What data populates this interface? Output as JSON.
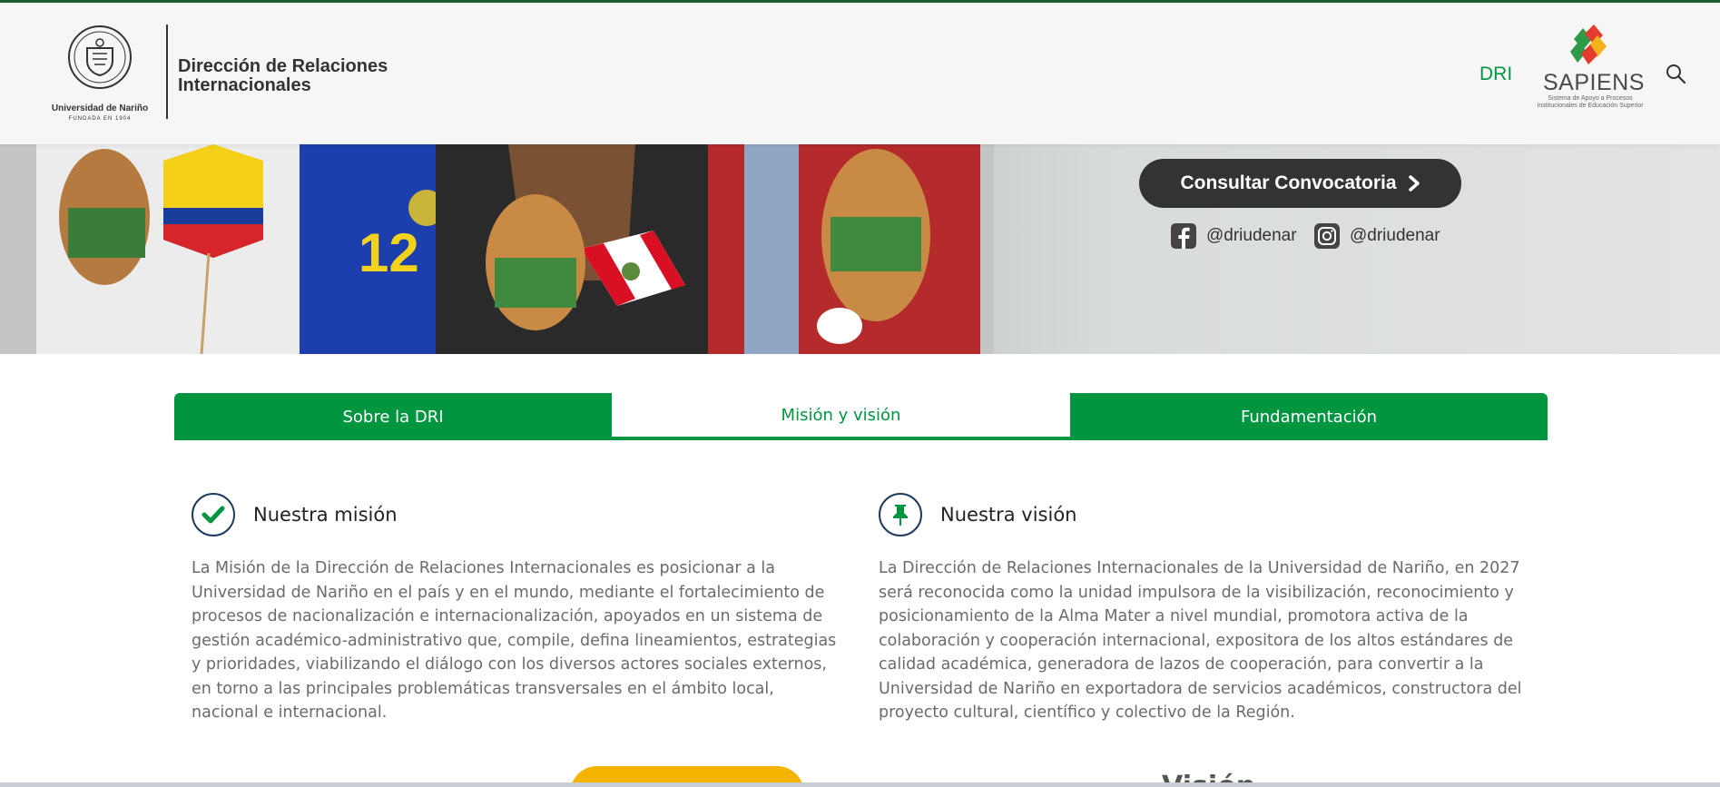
{
  "header": {
    "university_logo_name": "Universidad de Nariño",
    "university_logo_tagline": "FUNDADA EN 1904",
    "site_title_line1": "Dirección de Relaciones",
    "site_title_line2": "Internacionales",
    "nav_link": "DRI",
    "sapiens": {
      "name": "SAPIENS",
      "subtitle": "Sistema de Apoyo a Procesos Institucionales de Educación Superior"
    },
    "search_icon": "search-icon"
  },
  "hero": {
    "cta_label": "Consultar Convocatoria",
    "cta_icon": "chevron-right-icon",
    "facebook_handle": "@driudenar",
    "instagram_handle": "@driudenar"
  },
  "tabs": [
    {
      "label": "Sobre la DRI",
      "active": false
    },
    {
      "label": "Misión y visión",
      "active": true
    },
    {
      "label": "Fundamentación",
      "active": false
    }
  ],
  "mission": {
    "icon": "check-icon",
    "title": "Nuestra misión",
    "text": "La Misión de la Dirección de Relaciones Internacionales es posicionar a la Universidad de Nariño en el país y en el mundo, mediante el fortalecimiento de procesos de nacionalización e internacionalización, apoyados en un sistema de gestión académico-administrativo que, compile, defina lineamientos, estrategias y prioridades, viabilizando el diálogo con los diversos actores sociales externos, en torno a las principales problemáticas transversales en el ámbito local, nacional e internacional."
  },
  "vision": {
    "icon": "pin-icon",
    "title": "Nuestra visión",
    "text": "La Dirección de Relaciones Internacionales de la Universidad de Nariño, en 2027 será reconocida como la unidad impulsora de la visibilización, reconocimiento y posicionamiento de la Alma Mater a nivel mundial, promotora activa de la colaboración y cooperación internacional, expositora de los altos estándares de calidad académica, generadora de lazos de cooperación, para convertir a la Universidad de Nariño en exportadora de servicios académicos, constructora del proyecto cultural, científico y colectivo de la Región."
  },
  "bottom": {
    "partial_heading": "Visión"
  },
  "colors": {
    "green": "#009640",
    "dark_button": "#333333",
    "yellow": "#f4b400",
    "navy": "#1f3a5f"
  }
}
